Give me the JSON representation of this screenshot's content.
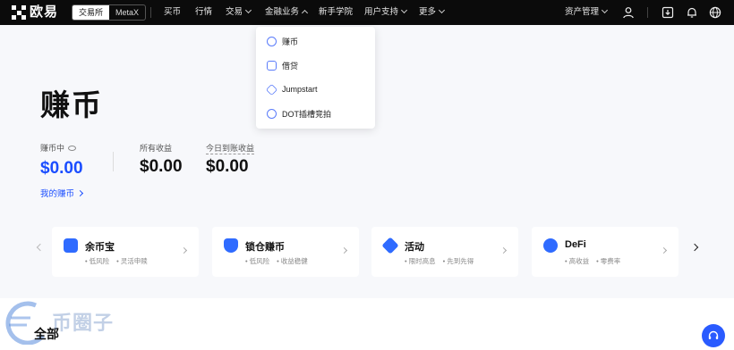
{
  "brand": {
    "name": "欧易"
  },
  "mode_switch": {
    "exchange": "交易所",
    "wallet": "MetaX"
  },
  "nav": {
    "buy": "买币",
    "markets": "行情",
    "trade": "交易",
    "finance": "金融业务",
    "learn": "新手学院",
    "support": "用户支持",
    "more": "更多"
  },
  "nav_right": {
    "assets": "资产管理"
  },
  "dropdown": {
    "items": [
      {
        "label": "赚币",
        "icon": "coin-icon"
      },
      {
        "label": "借贷",
        "icon": "loan-icon"
      },
      {
        "label": "Jumpstart",
        "icon": "jumpstart-icon"
      },
      {
        "label": "DOT插槽竞拍",
        "icon": "auction-icon"
      }
    ]
  },
  "hero": {
    "title": "赚币",
    "earning": {
      "label": "赚币中",
      "value": "$0.00"
    },
    "total": {
      "label": "所有收益",
      "value": "$0.00"
    },
    "today": {
      "label": "今日到账收益",
      "value": "$0.00"
    },
    "my_link": "我的赚币"
  },
  "cards": [
    {
      "title": "余币宝",
      "tags": [
        "低风险",
        "灵活申赎"
      ],
      "icon": "wallet-box-icon"
    },
    {
      "title": "锁仓赚币",
      "tags": [
        "低风险",
        "收益稳健"
      ],
      "icon": "lock-icon"
    },
    {
      "title": "活动",
      "tags": [
        "限时高息",
        "先到先得"
      ],
      "icon": "badge-percent-icon"
    },
    {
      "title": "DeFi",
      "tags": [
        "高收益",
        "零费率"
      ],
      "icon": "defi-icon"
    }
  ],
  "section": {
    "all_title": "全部"
  },
  "watermark": {
    "text": "币圈子"
  },
  "colors": {
    "accent": "#1a4dff",
    "nav_bg": "#0b0b0b",
    "card_icon": "#2f6bff"
  }
}
